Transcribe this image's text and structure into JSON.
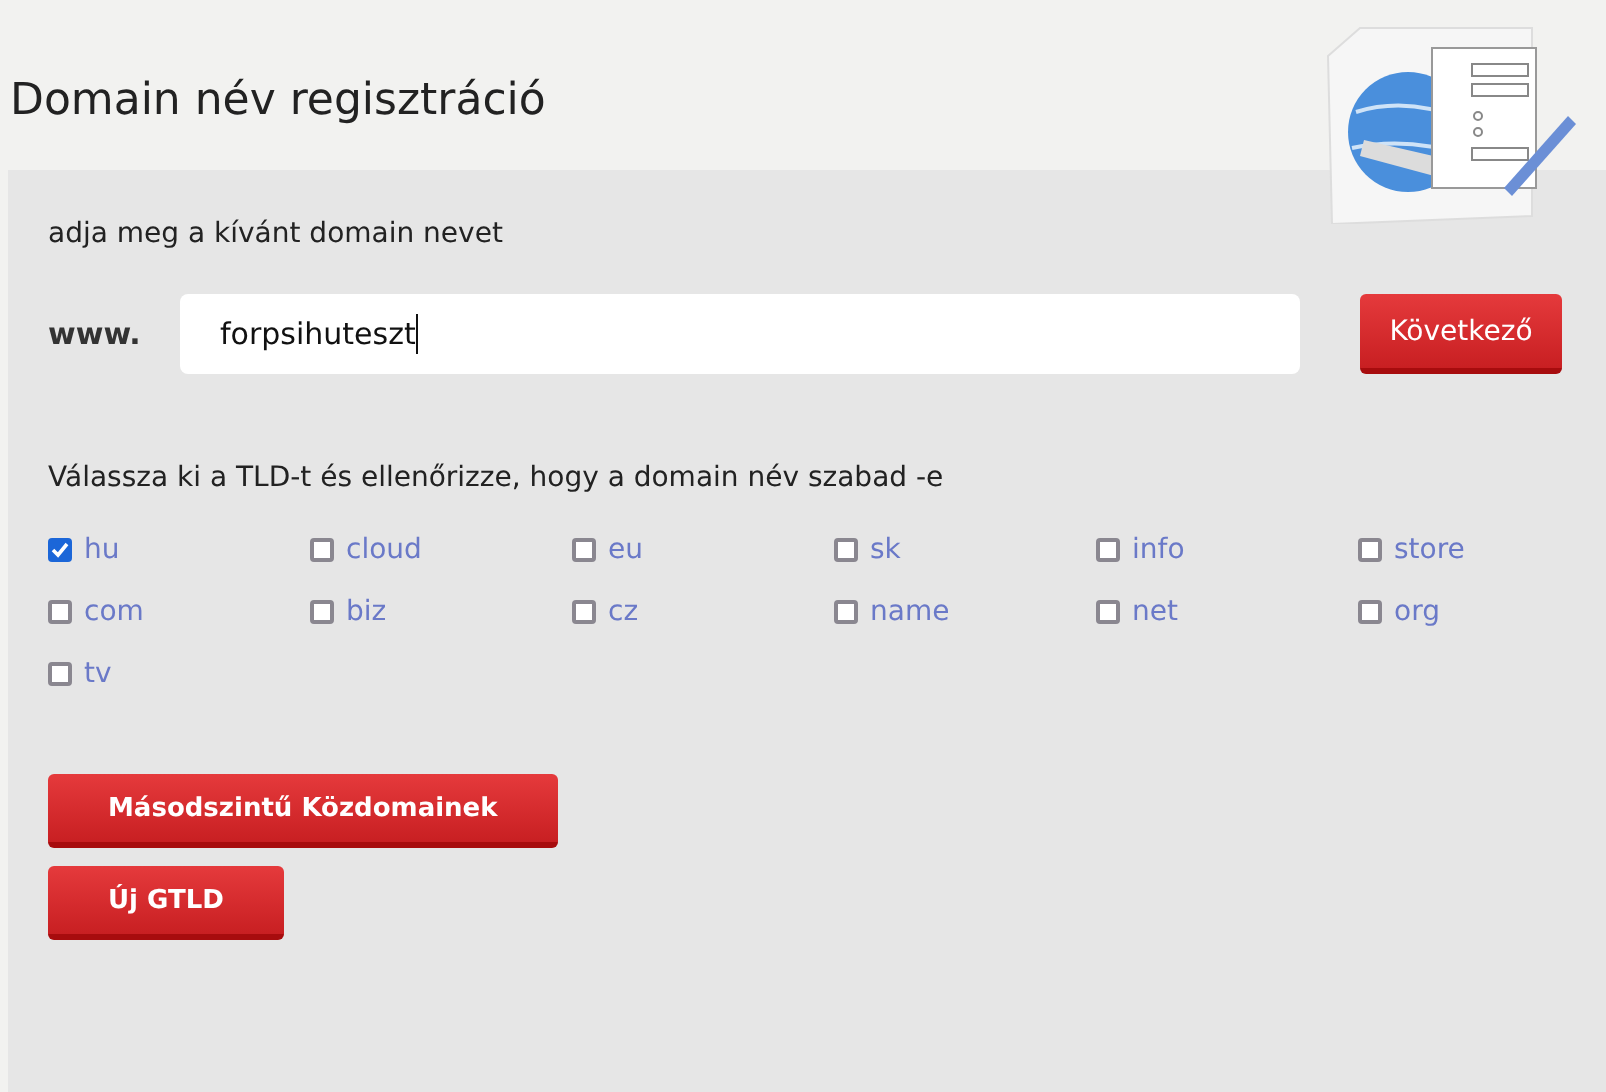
{
  "title": "Domain név regisztráció",
  "prompt": "adja meg a kívánt domain nevet",
  "domain": {
    "prefix": "www.",
    "value": "forpsihuteszt",
    "button": "Következő"
  },
  "tld_heading": "Válassza ki a TLD-t és ellenőrizze, hogy a domain név szabad -e",
  "tlds": [
    {
      "label": "hu",
      "checked": true
    },
    {
      "label": "cloud",
      "checked": false
    },
    {
      "label": "eu",
      "checked": false
    },
    {
      "label": "sk",
      "checked": false
    },
    {
      "label": "info",
      "checked": false
    },
    {
      "label": "store",
      "checked": false
    },
    {
      "label": "com",
      "checked": false
    },
    {
      "label": "biz",
      "checked": false
    },
    {
      "label": "cz",
      "checked": false
    },
    {
      "label": "name",
      "checked": false
    },
    {
      "label": "net",
      "checked": false
    },
    {
      "label": "org",
      "checked": false
    },
    {
      "label": "tv",
      "checked": false
    }
  ],
  "buttons": [
    "Másodszintű Közdomainek",
    "Új GTLD"
  ]
}
